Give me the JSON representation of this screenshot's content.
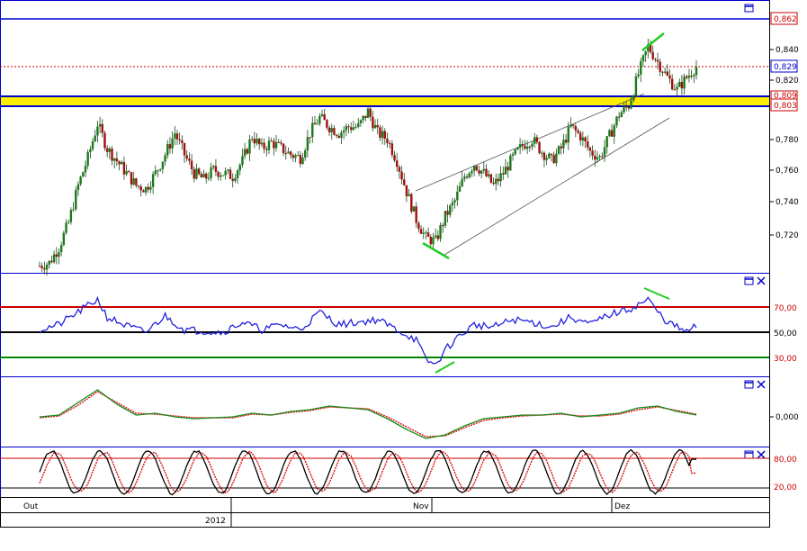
{
  "colors": {
    "frame": "#0000cc",
    "candle_up": "#1a7a1a",
    "candle_down": "#a01010",
    "resistance_line": "#0000cc",
    "current_price_line": "#cc0000",
    "support_band": "#ffee00",
    "divergence": "#22cc22",
    "channel": "#555555",
    "rsi_line": "#2222dd",
    "rsi_upper": "#cc0000",
    "rsi_mid": "#000000",
    "rsi_lower": "#008800",
    "macd_line": "#1a8a1a",
    "macd_signal": "#dd1111",
    "stoch_k": "#000000",
    "stoch_d": "#dd1111",
    "label_red_border": "#cc0000",
    "label_blue_border": "#0000cc"
  },
  "price_panel": {
    "y_ticks": [
      "0,840",
      "0,820",
      "0,800",
      "0,780",
      "0,760",
      "0,740",
      "0,720"
    ],
    "labels": {
      "resistance": "0,862",
      "current": "0,829",
      "band_top": "0,809",
      "band_bottom": "0,803"
    }
  },
  "rsi_panel": {
    "levels": [
      "70,00",
      "50,00",
      "30,00"
    ]
  },
  "macd_panel": {
    "zero_label": "0,000"
  },
  "stoch_panel": {
    "levels": [
      "80,00",
      "20,00"
    ]
  },
  "x_axis": {
    "months": [
      "Out",
      "Nov",
      "Dez"
    ],
    "year": "2012"
  },
  "chart_data": [
    {
      "type": "candlestick",
      "x": [
        "Out",
        "Nov",
        "Dez"
      ],
      "ylim": [
        0.7,
        0.87
      ],
      "y_ticks": [
        0.72,
        0.74,
        0.76,
        0.78,
        0.8,
        0.82,
        0.84
      ],
      "price_path": [
        [
          0,
          0.7
        ],
        [
          2,
          0.702
        ],
        [
          4,
          0.712
        ],
        [
          6,
          0.728
        ],
        [
          8,
          0.752
        ],
        [
          10,
          0.77
        ],
        [
          12,
          0.792
        ],
        [
          14,
          0.776
        ],
        [
          16,
          0.768
        ],
        [
          18,
          0.76
        ],
        [
          20,
          0.752
        ],
        [
          22,
          0.75
        ],
        [
          24,
          0.76
        ],
        [
          26,
          0.772
        ],
        [
          28,
          0.786
        ],
        [
          30,
          0.772
        ],
        [
          32,
          0.76
        ],
        [
          34,
          0.756
        ],
        [
          36,
          0.762
        ],
        [
          38,
          0.76
        ],
        [
          40,
          0.758
        ],
        [
          42,
          0.768
        ],
        [
          44,
          0.784
        ],
        [
          46,
          0.776
        ],
        [
          48,
          0.78
        ],
        [
          50,
          0.776
        ],
        [
          52,
          0.772
        ],
        [
          54,
          0.77
        ],
        [
          56,
          0.786
        ],
        [
          58,
          0.796
        ],
        [
          60,
          0.79
        ],
        [
          62,
          0.786
        ],
        [
          64,
          0.79
        ],
        [
          66,
          0.79
        ],
        [
          68,
          0.8
        ],
        [
          70,
          0.786
        ],
        [
          72,
          0.782
        ],
        [
          74,
          0.768
        ],
        [
          76,
          0.748
        ],
        [
          78,
          0.73
        ],
        [
          80,
          0.718
        ],
        [
          82,
          0.716
        ],
        [
          84,
          0.732
        ],
        [
          86,
          0.742
        ],
        [
          88,
          0.758
        ],
        [
          90,
          0.766
        ],
        [
          92,
          0.76
        ],
        [
          94,
          0.752
        ],
        [
          96,
          0.76
        ],
        [
          98,
          0.77
        ],
        [
          100,
          0.778
        ],
        [
          102,
          0.782
        ],
        [
          104,
          0.774
        ],
        [
          106,
          0.768
        ],
        [
          108,
          0.776
        ],
        [
          110,
          0.79
        ],
        [
          112,
          0.784
        ],
        [
          114,
          0.774
        ],
        [
          116,
          0.77
        ],
        [
          118,
          0.784
        ],
        [
          120,
          0.798
        ],
        [
          122,
          0.804
        ],
        [
          124,
          0.824
        ],
        [
          126,
          0.842
        ],
        [
          128,
          0.832
        ],
        [
          130,
          0.822
        ],
        [
          132,
          0.814
        ],
        [
          134,
          0.822
        ],
        [
          136,
          0.829
        ]
      ],
      "resistance_level": 0.862,
      "current_price": 0.829,
      "support_band": [
        0.803,
        0.809
      ]
    },
    {
      "type": "line",
      "name": "RSI",
      "ylim": [
        20,
        80
      ],
      "levels": [
        70,
        50,
        30
      ],
      "path": [
        [
          0,
          52
        ],
        [
          4,
          56
        ],
        [
          8,
          66
        ],
        [
          12,
          76
        ],
        [
          14,
          62
        ],
        [
          18,
          55
        ],
        [
          22,
          50
        ],
        [
          26,
          63
        ],
        [
          30,
          52
        ],
        [
          34,
          51
        ],
        [
          38,
          50
        ],
        [
          42,
          58
        ],
        [
          46,
          52
        ],
        [
          50,
          56
        ],
        [
          54,
          52
        ],
        [
          58,
          66
        ],
        [
          62,
          56
        ],
        [
          66,
          58
        ],
        [
          70,
          60
        ],
        [
          74,
          52
        ],
        [
          78,
          44
        ],
        [
          80,
          28
        ],
        [
          82,
          24
        ],
        [
          84,
          36
        ],
        [
          86,
          44
        ],
        [
          90,
          56
        ],
        [
          94,
          54
        ],
        [
          98,
          60
        ],
        [
          102,
          58
        ],
        [
          106,
          54
        ],
        [
          110,
          62
        ],
        [
          114,
          56
        ],
        [
          118,
          64
        ],
        [
          122,
          68
        ],
        [
          126,
          76
        ],
        [
          128,
          66
        ],
        [
          130,
          58
        ],
        [
          134,
          50
        ],
        [
          136,
          55
        ]
      ]
    },
    {
      "type": "line",
      "name": "MACD",
      "zero_line": 0.0,
      "macd": [
        [
          0,
          0.0
        ],
        [
          4,
          0.002
        ],
        [
          8,
          0.016
        ],
        [
          12,
          0.03
        ],
        [
          16,
          0.014
        ],
        [
          20,
          0.002
        ],
        [
          24,
          0.004
        ],
        [
          28,
          0.0
        ],
        [
          32,
          -0.002
        ],
        [
          36,
          -0.001
        ],
        [
          40,
          0.0
        ],
        [
          44,
          0.004
        ],
        [
          48,
          0.002
        ],
        [
          52,
          0.006
        ],
        [
          56,
          0.008
        ],
        [
          60,
          0.012
        ],
        [
          64,
          0.01
        ],
        [
          68,
          0.008
        ],
        [
          72,
          -0.002
        ],
        [
          76,
          -0.014
        ],
        [
          80,
          -0.024
        ],
        [
          84,
          -0.02
        ],
        [
          88,
          -0.01
        ],
        [
          92,
          -0.002
        ],
        [
          96,
          0.0
        ],
        [
          100,
          0.002
        ],
        [
          104,
          0.002
        ],
        [
          108,
          0.004
        ],
        [
          112,
          0.0
        ],
        [
          116,
          0.002
        ],
        [
          120,
          0.004
        ],
        [
          124,
          0.01
        ],
        [
          128,
          0.012
        ],
        [
          132,
          0.006
        ],
        [
          136,
          0.002
        ]
      ],
      "signal": [
        [
          0,
          -0.001
        ],
        [
          4,
          0.001
        ],
        [
          8,
          0.013
        ],
        [
          12,
          0.028
        ],
        [
          16,
          0.016
        ],
        [
          20,
          0.004
        ],
        [
          24,
          0.003
        ],
        [
          28,
          0.001
        ],
        [
          32,
          -0.001
        ],
        [
          36,
          -0.001
        ],
        [
          40,
          -0.001
        ],
        [
          44,
          0.003
        ],
        [
          48,
          0.002
        ],
        [
          52,
          0.005
        ],
        [
          56,
          0.007
        ],
        [
          60,
          0.011
        ],
        [
          64,
          0.01
        ],
        [
          68,
          0.009
        ],
        [
          72,
          0.0
        ],
        [
          76,
          -0.011
        ],
        [
          80,
          -0.022
        ],
        [
          84,
          -0.021
        ],
        [
          88,
          -0.012
        ],
        [
          92,
          -0.004
        ],
        [
          96,
          -0.001
        ],
        [
          100,
          0.001
        ],
        [
          104,
          0.002
        ],
        [
          108,
          0.003
        ],
        [
          112,
          0.001
        ],
        [
          116,
          0.001
        ],
        [
          120,
          0.003
        ],
        [
          124,
          0.008
        ],
        [
          128,
          0.011
        ],
        [
          132,
          0.007
        ],
        [
          136,
          0.003
        ]
      ]
    },
    {
      "type": "line",
      "name": "Stochastic",
      "ylim": [
        0,
        100
      ],
      "levels": [
        80,
        20
      ],
      "k_cycle_length": 10,
      "k_last": 78,
      "d_last": 50
    }
  ]
}
